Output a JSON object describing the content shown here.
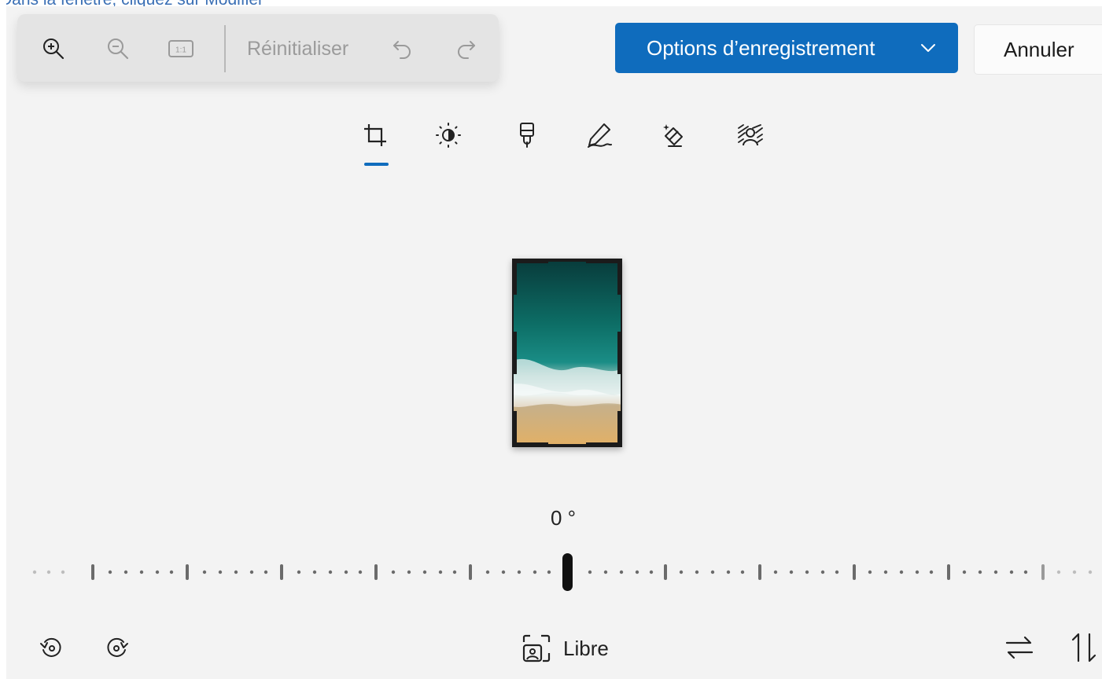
{
  "background_tutorial": {
    "text": "Dans la fenêtre, cliquez sur Modifier"
  },
  "zoom_toolbar": {
    "zoom_in_icon": "zoom-in-icon",
    "zoom_out_icon": "zoom-out-icon",
    "actual_size_icon": "actual-size-icon",
    "actual_size_text": "1:1",
    "reset_label": "Réinitialiser",
    "undo_icon": "undo-icon",
    "redo_icon": "redo-icon"
  },
  "header": {
    "save_label": "Options d’enregistrement",
    "cancel_label": "Annuler"
  },
  "tools": [
    {
      "name": "crop",
      "icon": "crop-icon",
      "active": true
    },
    {
      "name": "adjust",
      "icon": "brightness-icon"
    },
    {
      "name": "filter",
      "icon": "filter-icon"
    },
    {
      "name": "markup",
      "icon": "markup-icon"
    },
    {
      "name": "erase",
      "icon": "erase-icon"
    },
    {
      "name": "background",
      "icon": "background-blur-icon"
    }
  ],
  "rotation": {
    "angle_text": "0 °",
    "value_degrees": 0
  },
  "bottom_bar": {
    "rotate_left_icon": "rotate-left-icon",
    "rotate_right_icon": "rotate-right-icon",
    "aspect_ratio_label": "Libre",
    "flip_horizontal_icon": "flip-horizontal-icon",
    "flip_vertical_icon": "flip-vertical-icon"
  },
  "colors": {
    "accent": "#0f6cbd",
    "background": "#f3f3f3",
    "toolbar": "#e4e4e4"
  }
}
